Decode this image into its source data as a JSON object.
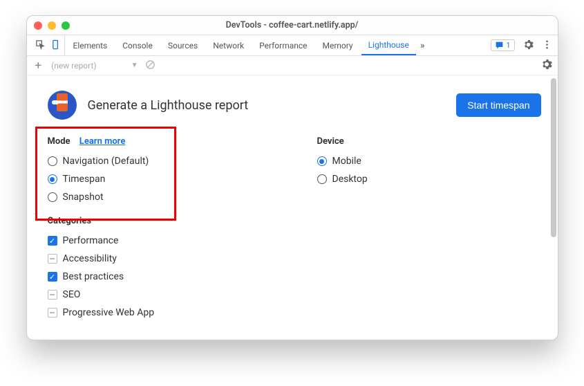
{
  "window": {
    "title": "DevTools - coffee-cart.netlify.app/"
  },
  "tabs": {
    "items": [
      {
        "label": "Elements"
      },
      {
        "label": "Console"
      },
      {
        "label": "Sources"
      },
      {
        "label": "Network"
      },
      {
        "label": "Performance"
      },
      {
        "label": "Memory"
      },
      {
        "label": "Lighthouse"
      }
    ],
    "active_index": 6,
    "messages_count": "1"
  },
  "toolbar": {
    "report_dropdown": "(new report)"
  },
  "page": {
    "title": "Generate a Lighthouse report",
    "start_button": "Start timespan"
  },
  "mode": {
    "title": "Mode",
    "learn_more": "Learn more",
    "options": [
      {
        "label": "Navigation (Default)"
      },
      {
        "label": "Timespan"
      },
      {
        "label": "Snapshot"
      }
    ],
    "selected_index": 1
  },
  "device": {
    "title": "Device",
    "options": [
      {
        "label": "Mobile"
      },
      {
        "label": "Desktop"
      }
    ],
    "selected_index": 0
  },
  "categories": {
    "title": "Categories",
    "items": [
      {
        "label": "Performance",
        "checked": true
      },
      {
        "label": "Accessibility",
        "checked": false
      },
      {
        "label": "Best practices",
        "checked": true
      },
      {
        "label": "SEO",
        "checked": false
      },
      {
        "label": "Progressive Web App",
        "checked": false
      }
    ]
  }
}
